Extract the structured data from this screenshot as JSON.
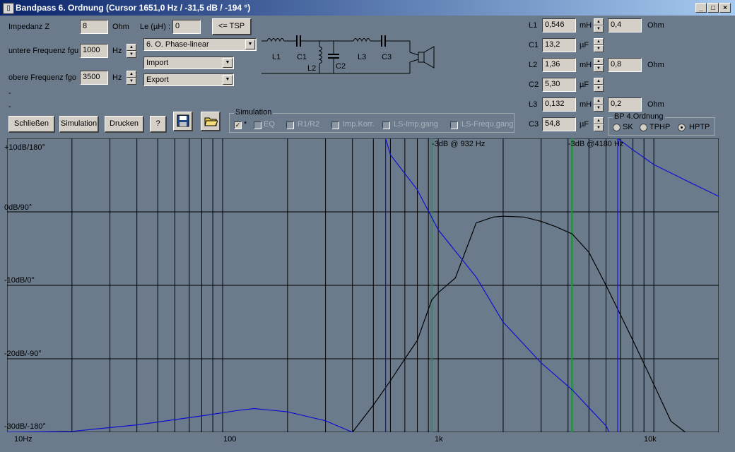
{
  "window": {
    "title": "Bandpass 6. Ordnung (Cursor 1651,0 Hz / -31,5 dB / -194 °)"
  },
  "inputs": {
    "impedance_label": "Impedanz Z",
    "impedance_value": "8",
    "impedance_unit": "Ohm",
    "le_label": "Le (µH) :",
    "le_value": "0",
    "tsp_button": "<= TSP",
    "fgu_label": "untere Frequenz fgu",
    "fgu_value": "1000",
    "fgu_unit": "Hz",
    "fgo_label": "obere Frequenz fgo",
    "fgo_value": "3500",
    "fgo_unit": "Hz",
    "dash1": "-",
    "dash2": "-"
  },
  "combos": {
    "filter_type": "6. O. Phase-linear",
    "import": "Import",
    "export": "Export"
  },
  "schematic": {
    "labels": [
      "L1",
      "C1",
      "L2",
      "C2",
      "L3",
      "C3"
    ]
  },
  "components": [
    {
      "name": "L1",
      "value": "0,546",
      "unit": "mH",
      "r_value": "0,4",
      "r_unit": "Ohm"
    },
    {
      "name": "C1",
      "value": "13,2",
      "unit": "µF"
    },
    {
      "name": "L2",
      "value": "1,36",
      "unit": "mH",
      "r_value": "0,8",
      "r_unit": "Ohm"
    },
    {
      "name": "C2",
      "value": "5,30",
      "unit": "µF"
    },
    {
      "name": "L3",
      "value": "0,132",
      "unit": "mH",
      "r_value": "0,2",
      "r_unit": "Ohm"
    },
    {
      "name": "C3",
      "value": "54,8",
      "unit": "µF"
    }
  ],
  "toolbar": {
    "close": "Schließen",
    "simulation": "Simulation",
    "print": "Drucken",
    "help": "?"
  },
  "simulation_group": {
    "title": "Simulation",
    "items": [
      {
        "label": "*",
        "checked": true,
        "enabled": true
      },
      {
        "label": "EQ",
        "checked": false,
        "enabled": false
      },
      {
        "label": "R1/R2",
        "checked": false,
        "enabled": false
      },
      {
        "label": "Imp.Korr.",
        "checked": false,
        "enabled": false
      },
      {
        "label": "LS-Imp.gang",
        "checked": false,
        "enabled": false
      },
      {
        "label": "LS-Frequ.gang",
        "checked": false,
        "enabled": false
      }
    ]
  },
  "bp_group": {
    "title": "BP 4.Ordnung",
    "options": [
      "SK",
      "TPHP",
      "HPTP"
    ],
    "selected": "HPTP"
  },
  "icons": {
    "save": "floppy-disk-icon",
    "open": "open-folder-icon",
    "window": "app-icon"
  },
  "colors": {
    "background": "#6b7b8c",
    "magnitude": "#000000",
    "phase": "#1010d0",
    "marker": "#2a8a4a"
  },
  "chart_data": {
    "type": "line",
    "x_scale": "log",
    "xlim": [
      10,
      20000
    ],
    "ylim_db": [
      -30,
      10
    ],
    "y_tick_labels": [
      "+10dB/180°",
      "0dB/90°",
      "-10dB/0°",
      "-20dB/-90°",
      "-30dB/-180°"
    ],
    "x_tick_labels": [
      "10Hz",
      "100",
      "1k",
      "10k"
    ],
    "markers": [
      {
        "freq": 932,
        "label": "-3dB @ 932 Hz"
      },
      {
        "freq": 4180,
        "label": "-3dB @4180 Hz"
      }
    ],
    "series": [
      {
        "key": "magnitude",
        "x": [
          400,
          500,
          600,
          700,
          800,
          932,
          1000,
          1200,
          1500,
          1800,
          2000,
          2500,
          3000,
          3500,
          4180,
          5000,
          6000,
          7000,
          8000,
          10000,
          12000,
          14000
        ],
        "y": [
          -30,
          -26.3,
          -23,
          -20,
          -17.5,
          -12,
          -11,
          -9,
          -1.5,
          -0.7,
          -0.6,
          -0.7,
          -1.3,
          -2,
          -3,
          -5.5,
          -10,
          -14,
          -17.5,
          -23.5,
          -28.5,
          -30
        ]
      },
      {
        "key": "phase",
        "x": [
          10,
          20,
          40,
          80,
          120,
          140,
          200,
          300,
          400,
          570,
          570,
          600,
          800,
          1000,
          1500,
          2000,
          3000,
          4180,
          5000,
          6000,
          6800,
          6800,
          8000,
          10000,
          15000,
          20000
        ],
        "y": [
          -180,
          -179,
          -171,
          -160,
          -153,
          -151,
          -155,
          -166,
          -180,
          -202,
          180,
          160,
          117,
          68,
          10,
          -45,
          -95,
          -128,
          -150,
          -172,
          -202,
          180,
          166,
          148,
          125,
          109
        ]
      }
    ]
  }
}
